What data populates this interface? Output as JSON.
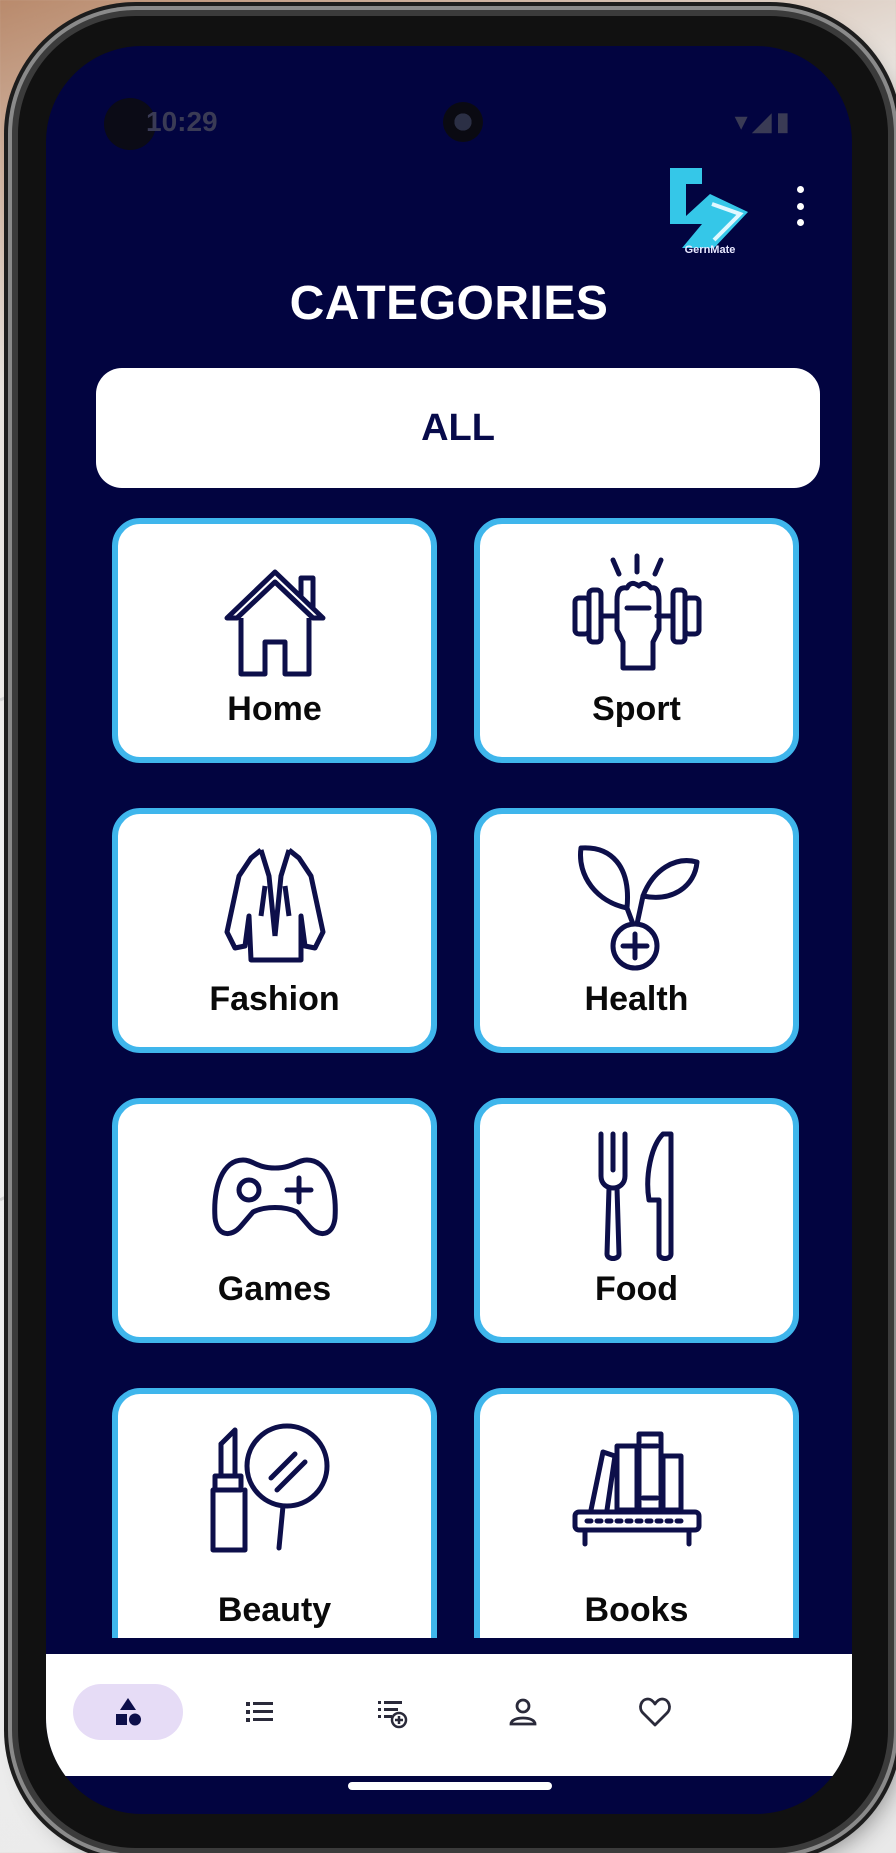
{
  "status": {
    "time": "10:29",
    "icons": "▾◢▮"
  },
  "app": {
    "logo_text": "GernMate",
    "title": "CATEGORIES",
    "all_label": "ALL"
  },
  "categories": [
    {
      "label": "Home",
      "icon": "house-icon"
    },
    {
      "label": "Sport",
      "icon": "dumbbell-icon"
    },
    {
      "label": "Fashion",
      "icon": "jacket-icon"
    },
    {
      "label": "Health",
      "icon": "leaf-plus-icon"
    },
    {
      "label": "Games",
      "icon": "gamepad-icon"
    },
    {
      "label": "Food",
      "icon": "fork-knife-icon"
    },
    {
      "label": "Beauty",
      "icon": "lipstick-mirror-icon"
    },
    {
      "label": "Books",
      "icon": "bookshelf-icon"
    }
  ],
  "bottom_nav": [
    {
      "icon": "shapes-icon",
      "active": true
    },
    {
      "icon": "list-icon",
      "active": false
    },
    {
      "icon": "playlist-add-icon",
      "active": false
    },
    {
      "icon": "person-icon",
      "active": false
    },
    {
      "icon": "heart-icon",
      "active": false
    }
  ],
  "colors": {
    "background": "#020440",
    "card_border": "#3fb6ec",
    "icon_stroke": "#0d0f4a",
    "nav_active": "#e6dcf6"
  }
}
